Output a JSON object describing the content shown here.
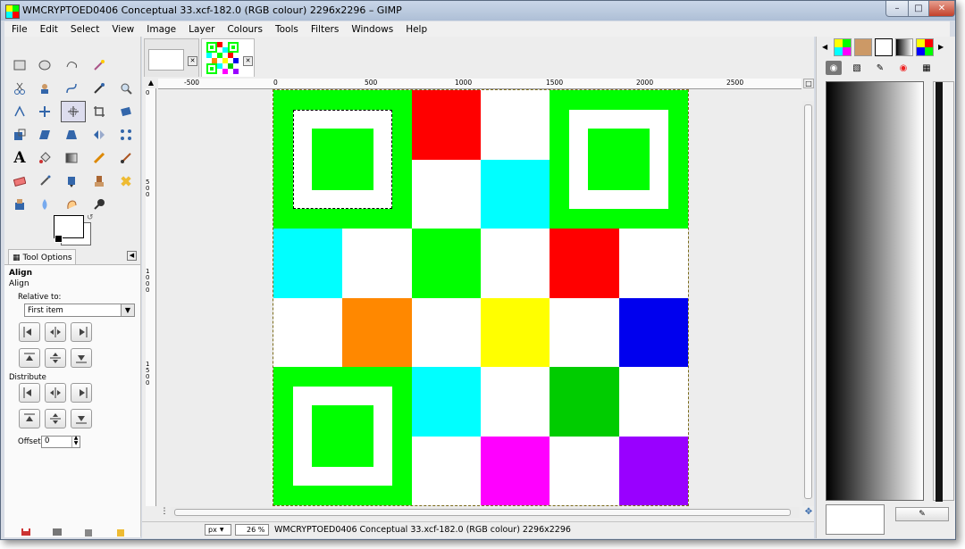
{
  "window": {
    "title": "WMCRYPTOED0406 Conceptual 33.xcf-182.0 (RGB colour) 2296x2296 – GIMP"
  },
  "menubar": {
    "items": [
      "File",
      "Edit",
      "Select",
      "View",
      "Image",
      "Layer",
      "Colours",
      "Tools",
      "Filters",
      "Windows",
      "Help"
    ]
  },
  "tool_options": {
    "tab_label": "Tool Options",
    "tool_title": "Align",
    "section_align": "Align",
    "relative_to_label": "Relative to:",
    "relative_to_value": "First item",
    "distribute_label": "Distribute",
    "offset_label": "Offset:",
    "offset_value": "0"
  },
  "ruler": {
    "h_ticks": [
      "-500",
      "0",
      "500",
      "1000",
      "1500",
      "2000",
      "2500"
    ],
    "v_ticks": [
      "0",
      "500",
      "1000",
      "1500"
    ]
  },
  "canvas": {
    "grid": [
      [
        "finder",
        "finder",
        "#ff0000",
        "#ffffff",
        "finder",
        "finder"
      ],
      [
        "finder",
        "finder",
        "#ffffff",
        "#00ffff",
        "finder",
        "finder"
      ],
      [
        "#00ffff",
        "#ffffff",
        "#00ff00",
        "#ffffff",
        "#ff0000",
        "#ffffff"
      ],
      [
        "#ffffff",
        "#ff8800",
        "#ffffff",
        "#ffff00",
        "#ffffff",
        "#0000ee"
      ],
      [
        "finder",
        "finder",
        "#00ffff",
        "#ffffff",
        "#00cc00",
        "#ffffff"
      ],
      [
        "finder",
        "finder",
        "#ffffff",
        "#ff00ff",
        "#ffffff",
        "#9900ff"
      ]
    ],
    "finder_color": "#00ff00"
  },
  "status": {
    "unit": "px",
    "zoom": "26 %",
    "text": "WMCRYPTOED0406 Conceptual 33.xcf-182.0 (RGB colour) 2296x2296"
  }
}
